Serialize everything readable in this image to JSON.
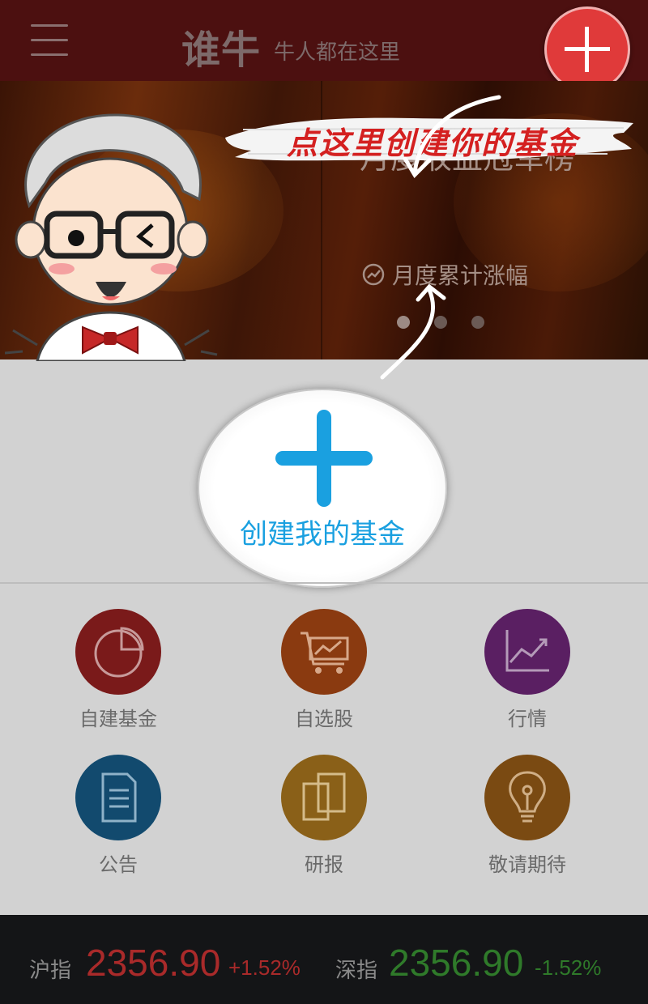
{
  "header": {
    "app_title": "谁牛",
    "slogan": "牛人都在这里",
    "menu_icon": "hamburger-menu-icon",
    "add_icon": "plus-icon"
  },
  "banner": {
    "title": "月度收益冠军榜",
    "sub_label": "月度累计涨幅",
    "active_dot": 0,
    "dot_count": 3
  },
  "guide": {
    "brush_text": "点这里创建你的基金"
  },
  "create": {
    "label": "创建我的基金"
  },
  "grid": [
    {
      "label": "自建基金",
      "icon": "pie-chart-icon",
      "color": "#7a1a1a"
    },
    {
      "label": "自选股",
      "icon": "shopping-cart-chart-icon",
      "color": "#8a3a10"
    },
    {
      "label": "行情",
      "icon": "line-chart-icon",
      "color": "#5a1f62"
    },
    {
      "label": "公告",
      "icon": "document-icon",
      "color": "#124a6e"
    },
    {
      "label": "研报",
      "icon": "report-pages-icon",
      "color": "#8a6018"
    },
    {
      "label": "敬请期待",
      "icon": "lightbulb-icon",
      "color": "#7a4a12"
    }
  ],
  "indices": [
    {
      "name": "沪指",
      "value": "2356.90",
      "change": "+1.52%",
      "trend": "up"
    },
    {
      "name": "深指",
      "value": "2356.90",
      "change": "-1.52%",
      "trend": "down"
    }
  ],
  "colors": {
    "header_bg": "#4c1010",
    "accent_red": "#e03a3a",
    "create_blue": "#1aa0e0",
    "bottom_bg": "#141517"
  }
}
